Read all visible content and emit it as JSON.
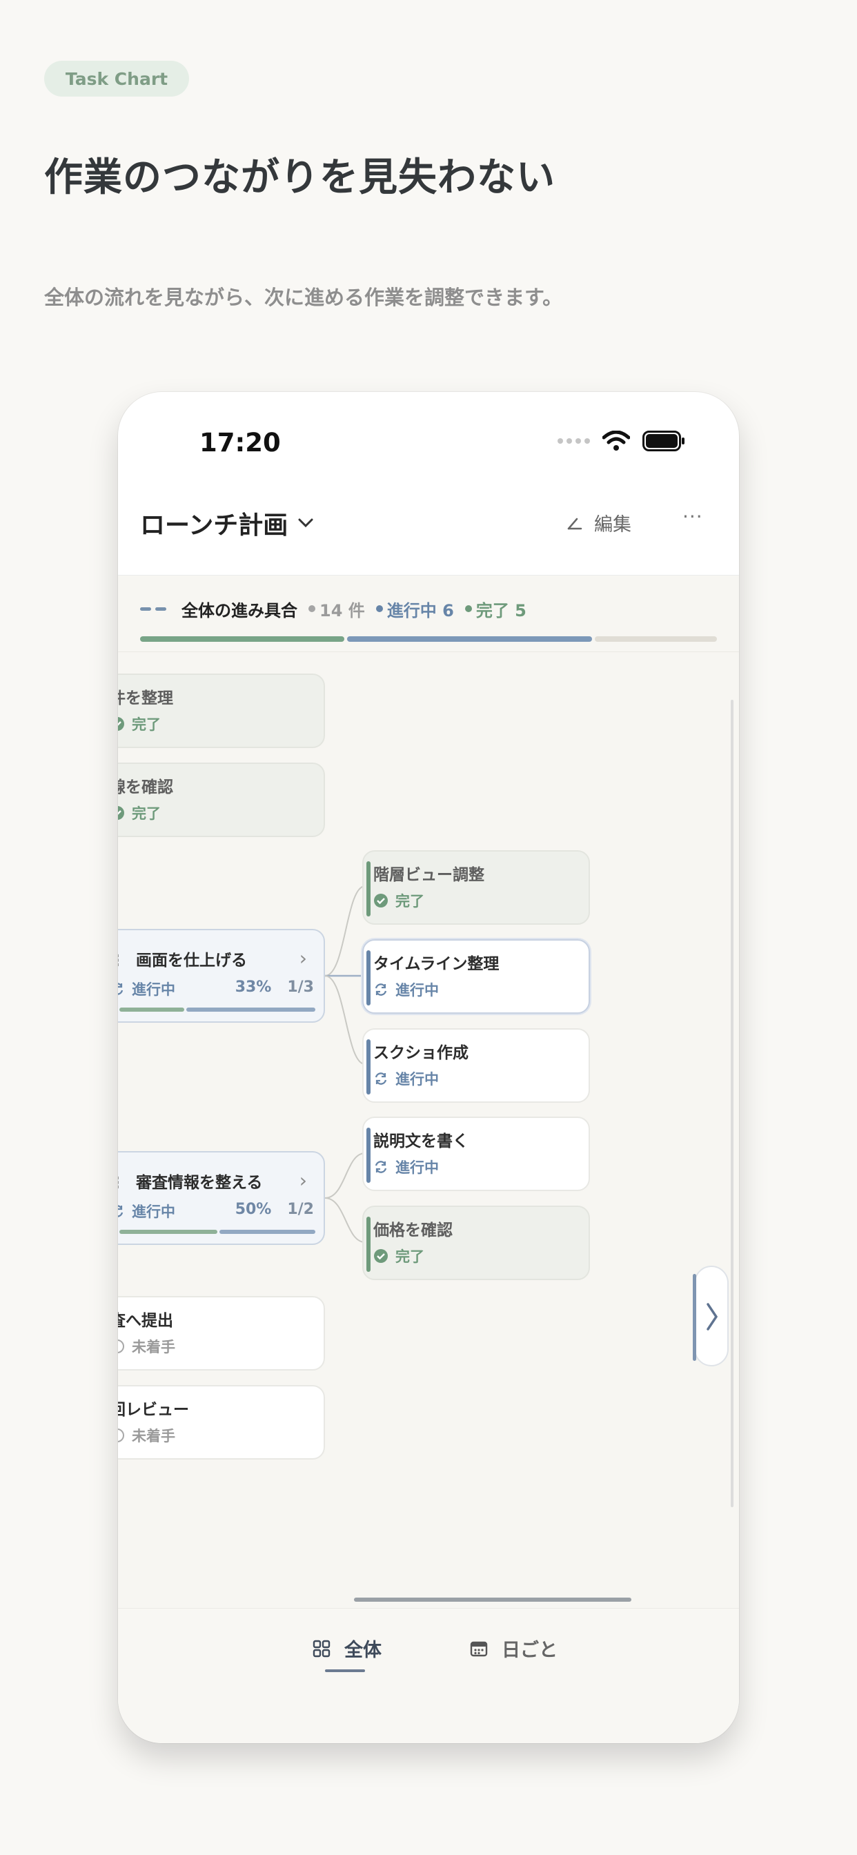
{
  "badge": "Task Chart",
  "headline": "作業のつながりを見失わない",
  "subline": "全体の流れを見ながら、次に進める作業を調整できます。",
  "status_bar": {
    "time": "17:20"
  },
  "nav": {
    "title": "ローンチ計画",
    "edit_label": "編集",
    "more_label": "···"
  },
  "progress": {
    "title": "全体の進み具合",
    "total": "14 件",
    "in_progress": "進行中 6",
    "done": "完了 5",
    "done_count": 5,
    "in_progress_count": 6,
    "total_count": 14
  },
  "cards_left": [
    {
      "title": "件を整理",
      "status": "完了",
      "state": "done"
    },
    {
      "title": "線を確認",
      "status": "完了",
      "state": "done"
    },
    {
      "title": "画面を仕上げる",
      "status": "進行中",
      "state": "parent",
      "percent": "33%",
      "count": "1/3",
      "progress": 0.33
    },
    {
      "title": "審査情報を整える",
      "status": "進行中",
      "state": "parent",
      "percent": "50%",
      "count": "1/2",
      "progress": 0.5
    },
    {
      "title": "査へ提出",
      "status": "未着手",
      "state": "todo"
    },
    {
      "title": "回レビュー",
      "status": "未着手",
      "state": "todo"
    }
  ],
  "cards_right": [
    {
      "title": "階層ビュー調整",
      "status": "完了",
      "state": "done"
    },
    {
      "title": "タイムライン整理",
      "status": "進行中",
      "state": "active"
    },
    {
      "title": "スクショ作成",
      "status": "進行中",
      "state": "progress"
    },
    {
      "title": "説明文を書く",
      "status": "進行中",
      "state": "progress"
    },
    {
      "title": "価格を確認",
      "status": "完了",
      "state": "done"
    }
  ],
  "tabs": [
    {
      "label": "全体",
      "icon": "grid-icon",
      "active": true
    },
    {
      "label": "日ごと",
      "icon": "calendar-icon",
      "active": false
    }
  ],
  "colors": {
    "done": "#6e9a7b",
    "in_progress": "#6785a8",
    "todo": "#9a9a9a",
    "bar_done": "#78a487",
    "bar_progress": "#7c98b8",
    "bar_remaining": "#e0ddd5"
  }
}
